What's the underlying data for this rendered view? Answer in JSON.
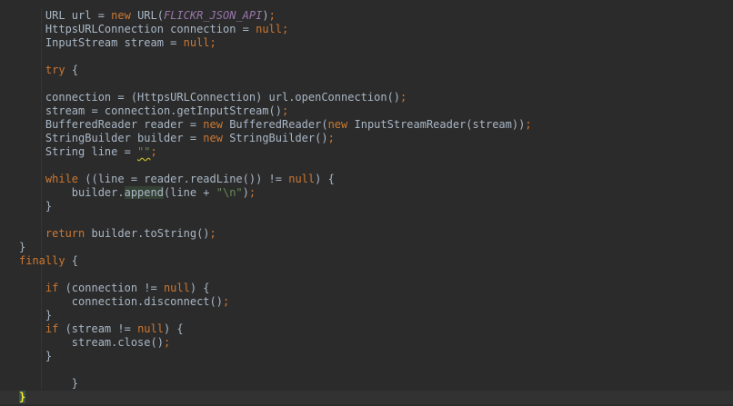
{
  "editor": {
    "lines": [
      [
        {
          "t": "    URL url = "
        },
        {
          "t": "new",
          "c": "kw"
        },
        {
          "t": " URL("
        },
        {
          "t": "FLICKR_JSON_API",
          "c": "const"
        },
        {
          "t": ")"
        },
        {
          "t": ";",
          "c": "kw"
        }
      ],
      [
        {
          "t": "    HttpsURLConnection connection = "
        },
        {
          "t": "null",
          "c": "kw"
        },
        {
          "t": ";",
          "c": "kw"
        }
      ],
      [
        {
          "t": "    InputStream stream = "
        },
        {
          "t": "null",
          "c": "kw"
        },
        {
          "t": ";",
          "c": "kw"
        }
      ],
      [],
      [
        {
          "t": "    "
        },
        {
          "t": "try",
          "c": "kw"
        },
        {
          "t": " {"
        }
      ],
      [],
      [
        {
          "t": "    connection = (HttpsURLConnection) url.openConnection()"
        },
        {
          "t": ";",
          "c": "kw"
        }
      ],
      [
        {
          "t": "    stream = connection.getInputStream()"
        },
        {
          "t": ";",
          "c": "kw"
        }
      ],
      [
        {
          "t": "    BufferedReader reader = "
        },
        {
          "t": "new",
          "c": "kw"
        },
        {
          "t": " BufferedReader("
        },
        {
          "t": "new",
          "c": "kw"
        },
        {
          "t": " InputStreamReader(stream))"
        },
        {
          "t": ";",
          "c": "kw"
        }
      ],
      [
        {
          "t": "    StringBuilder builder = "
        },
        {
          "t": "new",
          "c": "kw"
        },
        {
          "t": " StringBuilder()"
        },
        {
          "t": ";",
          "c": "kw"
        }
      ],
      [
        {
          "t": "    String line = "
        },
        {
          "t": "\"\"",
          "c": "str-warn"
        },
        {
          "t": ";",
          "c": "kw"
        }
      ],
      [],
      [
        {
          "t": "    "
        },
        {
          "t": "while",
          "c": "kw"
        },
        {
          "t": " ((line = reader.readLine()) != "
        },
        {
          "t": "null",
          "c": "kw"
        },
        {
          "t": ") {"
        }
      ],
      [
        {
          "t": "        builder."
        },
        {
          "t": "append",
          "c": "hl"
        },
        {
          "t": "(line + "
        },
        {
          "t": "\"\\n\"",
          "c": "str"
        },
        {
          "t": ")"
        },
        {
          "t": ";",
          "c": "kw"
        }
      ],
      [
        {
          "t": "    }"
        }
      ],
      [],
      [
        {
          "t": "    "
        },
        {
          "t": "return",
          "c": "kw"
        },
        {
          "t": " builder.toString()"
        },
        {
          "t": ";",
          "c": "kw"
        }
      ],
      [
        {
          "t": "}"
        }
      ],
      [
        {
          "t": "finally",
          "c": "kw"
        },
        {
          "t": " {"
        }
      ],
      [],
      [
        {
          "t": "    "
        },
        {
          "t": "if",
          "c": "kw"
        },
        {
          "t": " (connection != "
        },
        {
          "t": "null",
          "c": "kw"
        },
        {
          "t": ") {"
        }
      ],
      [
        {
          "t": "        connection.disconnect()"
        },
        {
          "t": ";",
          "c": "kw"
        }
      ],
      [
        {
          "t": "    }"
        }
      ],
      [
        {
          "t": "    "
        },
        {
          "t": "if",
          "c": "kw"
        },
        {
          "t": " (stream != "
        },
        {
          "t": "null",
          "c": "kw"
        },
        {
          "t": ") {"
        }
      ],
      [
        {
          "t": "        stream.close()"
        },
        {
          "t": ";",
          "c": "kw"
        }
      ],
      [
        {
          "t": "    }"
        }
      ],
      [],
      [
        {
          "t": "        }"
        }
      ],
      [
        {
          "t": "}",
          "c": "brace"
        }
      ]
    ],
    "current_line": 28,
    "colors": {
      "background": "#2b2b2b",
      "text": "#a9b7c6",
      "keyword": "#cc7832",
      "constant": "#9876aa",
      "string": "#6a8759",
      "current_line": "#323232",
      "brace_match": "#ffef28",
      "usage_highlight": "#344134"
    }
  }
}
